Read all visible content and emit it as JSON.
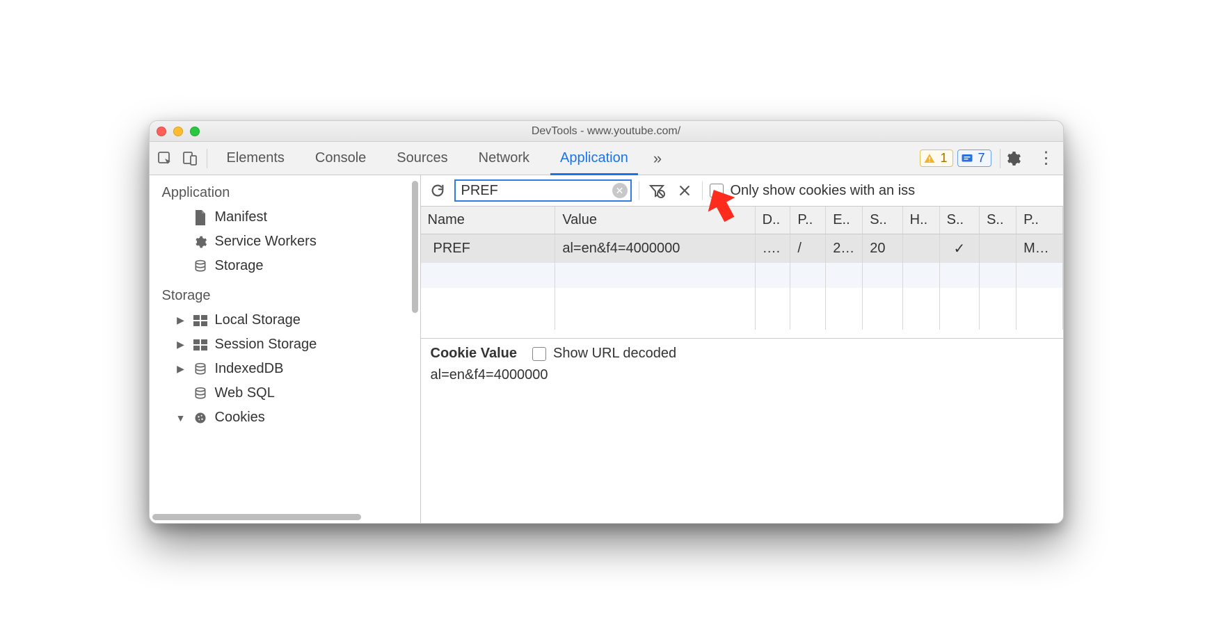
{
  "window": {
    "title": "DevTools - www.youtube.com/"
  },
  "tabs": {
    "items": [
      "Elements",
      "Console",
      "Sources",
      "Network",
      "Application"
    ],
    "active_index": 4,
    "overflow_glyph": "»"
  },
  "status": {
    "warn_count": "1",
    "info_count": "7"
  },
  "sidebar": {
    "groups": [
      {
        "title": "Application",
        "items": [
          {
            "icon": "file",
            "label": "Manifest",
            "disc": false
          },
          {
            "icon": "gear",
            "label": "Service Workers",
            "disc": false
          },
          {
            "icon": "db",
            "label": "Storage",
            "disc": false
          }
        ]
      },
      {
        "title": "Storage",
        "items": [
          {
            "icon": "grid",
            "label": "Local Storage",
            "disc": true,
            "disc_glyph": "▶"
          },
          {
            "icon": "grid",
            "label": "Session Storage",
            "disc": true,
            "disc_glyph": "▶"
          },
          {
            "icon": "db",
            "label": "IndexedDB",
            "disc": true,
            "disc_glyph": "▶"
          },
          {
            "icon": "db",
            "label": "Web SQL",
            "disc": false
          },
          {
            "icon": "cookie",
            "label": "Cookies",
            "disc": true,
            "disc_glyph": "▼"
          }
        ]
      }
    ]
  },
  "toolbar": {
    "filter_value": "PREF",
    "only_issues_label": "Only show cookies with an iss"
  },
  "table": {
    "columns": [
      "Name",
      "Value",
      "D..",
      "P..",
      "E..",
      "S..",
      "H..",
      "S..",
      "S..",
      "P.."
    ],
    "rows": [
      {
        "Name": "PREF",
        "Value": "al=en&f4=4000000",
        "D": "….",
        "P": "/",
        "E": "2…",
        "S1": "20",
        "H": "",
        "S2": "✓",
        "S3": "",
        "PL": "M…",
        "selected": true
      }
    ]
  },
  "detail": {
    "title": "Cookie Value",
    "show_decoded_label": "Show URL decoded",
    "value": "al=en&f4=4000000"
  }
}
